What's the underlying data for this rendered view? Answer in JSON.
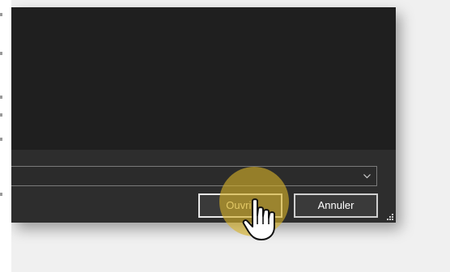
{
  "dialog": {
    "filetype_combo": {
      "value": ""
    },
    "buttons": {
      "open_label": "Ouvrir",
      "cancel_label": "Annuler"
    }
  },
  "icons": {
    "combo_chevron": "chevron-down-icon",
    "resize_grip": "resize-grip-icon",
    "cursor": "hand-pointer-icon"
  },
  "colors": {
    "dialog_bg": "#2b2b2b",
    "content_bg": "#1f1f1f",
    "highlight": "#d6b228",
    "page_bg": "#f0f0f0"
  }
}
